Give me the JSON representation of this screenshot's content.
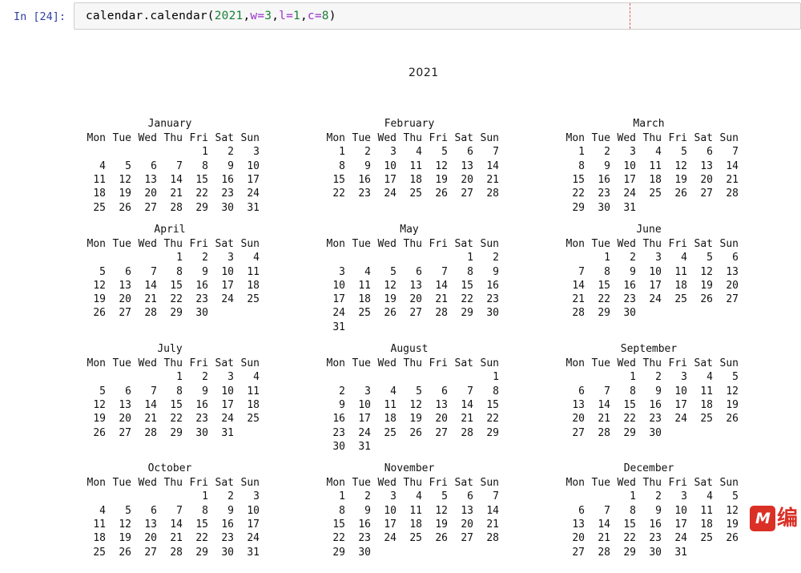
{
  "notebook": {
    "prompt_label": "In [24]:",
    "code": {
      "full": "calendar.calendar(2021,w=3,l=1,c=8)",
      "part_call": "calendar.calendar(",
      "part_year": "2021",
      "sep1": ",",
      "kw_w": "w=",
      "val_w": "3",
      "sep2": ",",
      "kw_l": "l=",
      "val_l": "1",
      "sep3": ",",
      "kw_c": "c=",
      "val_c": "8",
      "close": ")"
    },
    "colors": {
      "prompt": "#303f9f",
      "number": "#1a7f37",
      "keyword": "#9a32cd",
      "ruler": "#e05c5c",
      "cell_bg": "#f7f7f7",
      "cell_border": "#cfcfcf",
      "watermark": "#d9281e"
    }
  },
  "calendar": {
    "year": "2021",
    "weekday_headers": [
      "Mon",
      "Tue",
      "Wed",
      "Thu",
      "Fri",
      "Sat",
      "Sun"
    ],
    "quarters": [
      [
        {
          "name": "January",
          "weeks": [
            [
              "",
              "",
              "",
              "",
              "1",
              "2",
              "3"
            ],
            [
              "4",
              "5",
              "6",
              "7",
              "8",
              "9",
              "10"
            ],
            [
              "11",
              "12",
              "13",
              "14",
              "15",
              "16",
              "17"
            ],
            [
              "18",
              "19",
              "20",
              "21",
              "22",
              "23",
              "24"
            ],
            [
              "25",
              "26",
              "27",
              "28",
              "29",
              "30",
              "31"
            ]
          ]
        },
        {
          "name": "February",
          "weeks": [
            [
              "1",
              "2",
              "3",
              "4",
              "5",
              "6",
              "7"
            ],
            [
              "8",
              "9",
              "10",
              "11",
              "12",
              "13",
              "14"
            ],
            [
              "15",
              "16",
              "17",
              "18",
              "19",
              "20",
              "21"
            ],
            [
              "22",
              "23",
              "24",
              "25",
              "26",
              "27",
              "28"
            ]
          ]
        },
        {
          "name": "March",
          "weeks": [
            [
              "1",
              "2",
              "3",
              "4",
              "5",
              "6",
              "7"
            ],
            [
              "8",
              "9",
              "10",
              "11",
              "12",
              "13",
              "14"
            ],
            [
              "15",
              "16",
              "17",
              "18",
              "19",
              "20",
              "21"
            ],
            [
              "22",
              "23",
              "24",
              "25",
              "26",
              "27",
              "28"
            ],
            [
              "29",
              "30",
              "31",
              "",
              "",
              "",
              ""
            ]
          ]
        }
      ],
      [
        {
          "name": "April",
          "weeks": [
            [
              "",
              "",
              "",
              "1",
              "2",
              "3",
              "4"
            ],
            [
              "5",
              "6",
              "7",
              "8",
              "9",
              "10",
              "11"
            ],
            [
              "12",
              "13",
              "14",
              "15",
              "16",
              "17",
              "18"
            ],
            [
              "19",
              "20",
              "21",
              "22",
              "23",
              "24",
              "25"
            ],
            [
              "26",
              "27",
              "28",
              "29",
              "30",
              "",
              ""
            ]
          ]
        },
        {
          "name": "May",
          "weeks": [
            [
              "",
              "",
              "",
              "",
              "",
              "1",
              "2"
            ],
            [
              "3",
              "4",
              "5",
              "6",
              "7",
              "8",
              "9"
            ],
            [
              "10",
              "11",
              "12",
              "13",
              "14",
              "15",
              "16"
            ],
            [
              "17",
              "18",
              "19",
              "20",
              "21",
              "22",
              "23"
            ],
            [
              "24",
              "25",
              "26",
              "27",
              "28",
              "29",
              "30"
            ],
            [
              "31",
              "",
              "",
              "",
              "",
              "",
              ""
            ]
          ]
        },
        {
          "name": "June",
          "weeks": [
            [
              "",
              "1",
              "2",
              "3",
              "4",
              "5",
              "6"
            ],
            [
              "7",
              "8",
              "9",
              "10",
              "11",
              "12",
              "13"
            ],
            [
              "14",
              "15",
              "16",
              "17",
              "18",
              "19",
              "20"
            ],
            [
              "21",
              "22",
              "23",
              "24",
              "25",
              "26",
              "27"
            ],
            [
              "28",
              "29",
              "30",
              "",
              "",
              "",
              ""
            ]
          ]
        }
      ],
      [
        {
          "name": "July",
          "weeks": [
            [
              "",
              "",
              "",
              "1",
              "2",
              "3",
              "4"
            ],
            [
              "5",
              "6",
              "7",
              "8",
              "9",
              "10",
              "11"
            ],
            [
              "12",
              "13",
              "14",
              "15",
              "16",
              "17",
              "18"
            ],
            [
              "19",
              "20",
              "21",
              "22",
              "23",
              "24",
              "25"
            ],
            [
              "26",
              "27",
              "28",
              "29",
              "30",
              "31",
              ""
            ]
          ]
        },
        {
          "name": "August",
          "weeks": [
            [
              "",
              "",
              "",
              "",
              "",
              "",
              "1"
            ],
            [
              "2",
              "3",
              "4",
              "5",
              "6",
              "7",
              "8"
            ],
            [
              "9",
              "10",
              "11",
              "12",
              "13",
              "14",
              "15"
            ],
            [
              "16",
              "17",
              "18",
              "19",
              "20",
              "21",
              "22"
            ],
            [
              "23",
              "24",
              "25",
              "26",
              "27",
              "28",
              "29"
            ],
            [
              "30",
              "31",
              "",
              "",
              "",
              "",
              ""
            ]
          ]
        },
        {
          "name": "September",
          "weeks": [
            [
              "",
              "",
              "1",
              "2",
              "3",
              "4",
              "5"
            ],
            [
              "6",
              "7",
              "8",
              "9",
              "10",
              "11",
              "12"
            ],
            [
              "13",
              "14",
              "15",
              "16",
              "17",
              "18",
              "19"
            ],
            [
              "20",
              "21",
              "22",
              "23",
              "24",
              "25",
              "26"
            ],
            [
              "27",
              "28",
              "29",
              "30",
              "",
              "",
              ""
            ]
          ]
        }
      ],
      [
        {
          "name": "October",
          "weeks": [
            [
              "",
              "",
              "",
              "",
              "1",
              "2",
              "3"
            ],
            [
              "4",
              "5",
              "6",
              "7",
              "8",
              "9",
              "10"
            ],
            [
              "11",
              "12",
              "13",
              "14",
              "15",
              "16",
              "17"
            ],
            [
              "18",
              "19",
              "20",
              "21",
              "22",
              "23",
              "24"
            ],
            [
              "25",
              "26",
              "27",
              "28",
              "29",
              "30",
              "31"
            ]
          ]
        },
        {
          "name": "November",
          "weeks": [
            [
              "1",
              "2",
              "3",
              "4",
              "5",
              "6",
              "7"
            ],
            [
              "8",
              "9",
              "10",
              "11",
              "12",
              "13",
              "14"
            ],
            [
              "15",
              "16",
              "17",
              "18",
              "19",
              "20",
              "21"
            ],
            [
              "22",
              "23",
              "24",
              "25",
              "26",
              "27",
              "28"
            ],
            [
              "29",
              "30",
              "",
              "",
              "",
              "",
              ""
            ]
          ]
        },
        {
          "name": "December",
          "weeks": [
            [
              "",
              "",
              "1",
              "2",
              "3",
              "4",
              "5"
            ],
            [
              "6",
              "7",
              "8",
              "9",
              "10",
              "11",
              "12"
            ],
            [
              "13",
              "14",
              "15",
              "16",
              "17",
              "18",
              "19"
            ],
            [
              "20",
              "21",
              "22",
              "23",
              "24",
              "25",
              "26"
            ],
            [
              "27",
              "28",
              "29",
              "30",
              "31",
              "",
              ""
            ]
          ]
        }
      ]
    ]
  },
  "watermark": {
    "badge_text": "M",
    "cjk_text": "编"
  }
}
